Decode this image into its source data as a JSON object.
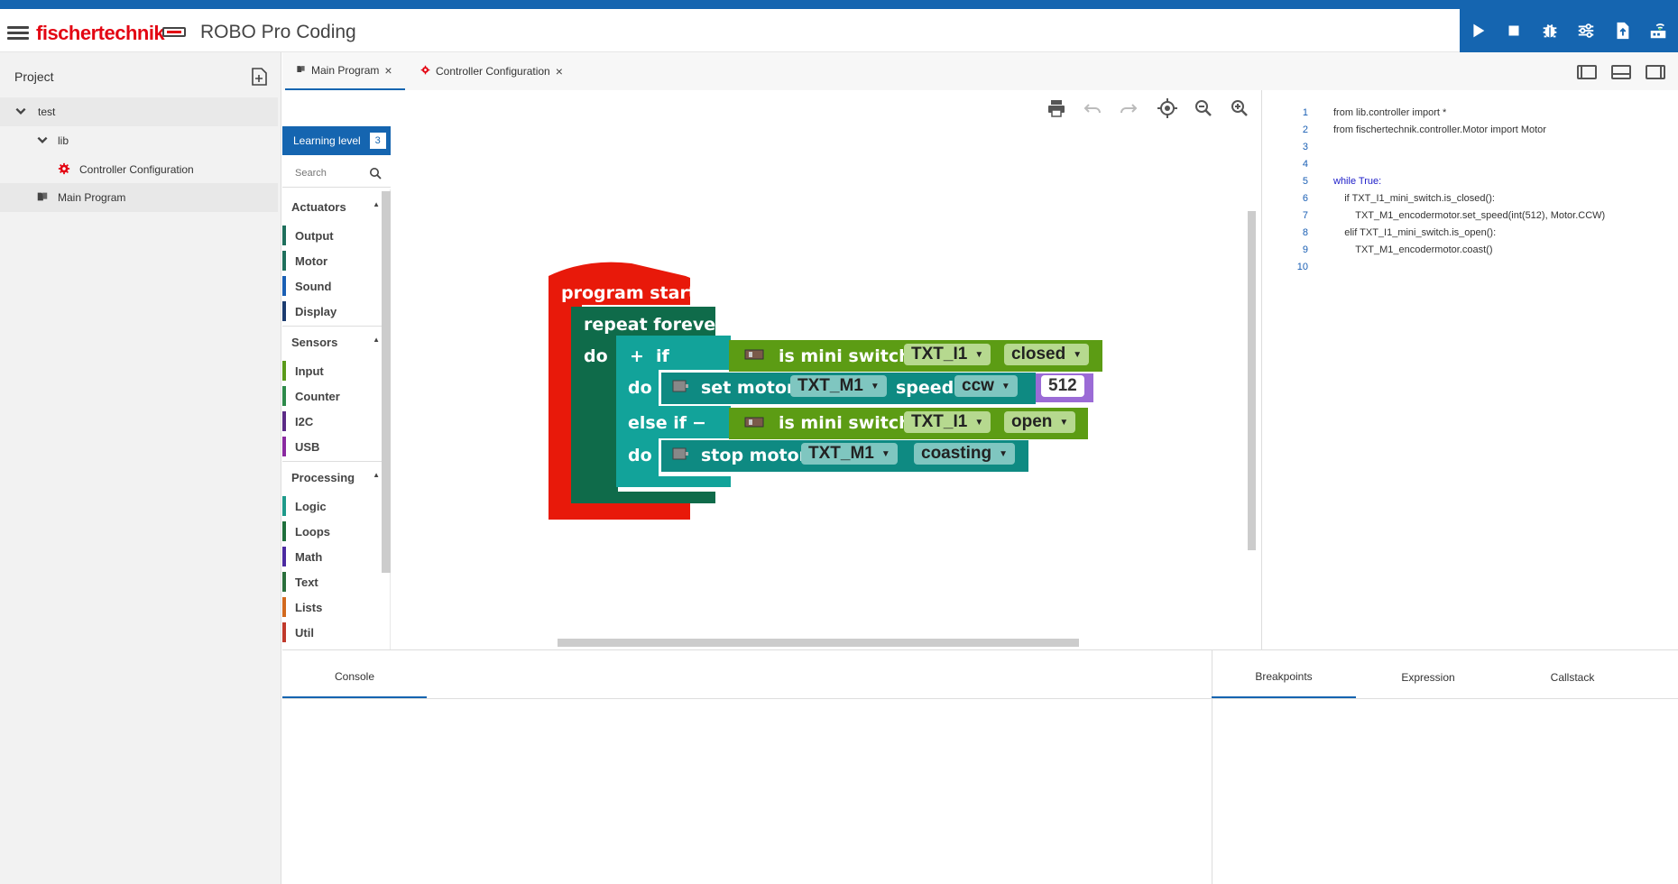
{
  "header": {
    "brand": "fischertechnik",
    "app_title": "ROBO Pro Coding",
    "colors": {
      "primary": "#1565b0",
      "brand_red": "#e30613"
    },
    "toolbar_icons": [
      "play-icon",
      "stop-icon",
      "debug-icon",
      "settings-sliders-icon",
      "upload-icon",
      "controller-connect-icon"
    ]
  },
  "sidebar": {
    "title": "Project",
    "tree": [
      {
        "label": "test",
        "icon": "chevron-down-icon"
      },
      {
        "label": "lib",
        "icon": "chevron-down-icon"
      },
      {
        "label": "Controller Configuration",
        "icon": "gear-icon"
      },
      {
        "label": "Main Program",
        "icon": "program-icon"
      }
    ]
  },
  "tabs": [
    {
      "label": "Main Program",
      "active": true
    },
    {
      "label": "Controller Configuration",
      "active": false
    }
  ],
  "toolbox": {
    "learning_label": "Learning level",
    "learning_level": "3",
    "search_placeholder": "Search",
    "categories": [
      {
        "name": "Actuators",
        "items": [
          {
            "label": "Output",
            "color": "#1e6f5c"
          },
          {
            "label": "Motor",
            "color": "#1e6f5c"
          },
          {
            "label": "Sound",
            "color": "#1a5fb4"
          },
          {
            "label": "Display",
            "color": "#1b3b6f"
          }
        ]
      },
      {
        "name": "Sensors",
        "items": [
          {
            "label": "Input",
            "color": "#5a9a1a"
          },
          {
            "label": "Counter",
            "color": "#2d8a4a"
          },
          {
            "label": "I2C",
            "color": "#5b2a86"
          },
          {
            "label": "USB",
            "color": "#8a2aa0"
          }
        ]
      },
      {
        "name": "Processing",
        "items": [
          {
            "label": "Logic",
            "color": "#1e9a8a"
          },
          {
            "label": "Loops",
            "color": "#1e6f3c"
          },
          {
            "label": "Math",
            "color": "#4b2aa0"
          },
          {
            "label": "Text",
            "color": "#2a6f3c"
          },
          {
            "label": "Lists",
            "color": "#d2691e"
          },
          {
            "label": "Util",
            "color": "#c0392b"
          }
        ]
      }
    ]
  },
  "blocks": {
    "program_start": "program start",
    "repeat_forever": "repeat forever",
    "do": "do",
    "plus": "+",
    "minus": "−",
    "if": "if",
    "else_if": "else if",
    "is_mini_switch": "is mini switch",
    "switch_1": "TXT_I1",
    "state_1": "closed",
    "set_motor": "set motor",
    "motor_1": "TXT_M1",
    "speed": "speed",
    "direction": "ccw",
    "speed_value": "512",
    "switch_2": "TXT_I1",
    "state_2": "open",
    "stop_motor": "stop motor",
    "motor_2": "TXT_M1",
    "stop_mode": "coasting",
    "colors": {
      "program": "#e8190a",
      "loop": "#0f6b4a",
      "if": "#12a39a",
      "sensor": "#5c9c14",
      "motor": "#0e8a82",
      "number": "#9b6bd6"
    }
  },
  "code": {
    "line_numbers": [
      "1",
      "2",
      "3",
      "4",
      "5",
      "6",
      "7",
      "8",
      "9",
      "10"
    ],
    "lines": [
      "from lib.controller import *",
      "from fischertechnik.controller.Motor import Motor",
      "",
      "",
      "while True:",
      "    if TXT_I1_mini_switch.is_closed():",
      "        TXT_M1_encodermotor.set_speed(int(512), Motor.CCW)",
      "    elif TXT_I1_mini_switch.is_open():",
      "        TXT_M1_encodermotor.coast()",
      ""
    ]
  },
  "bottom": {
    "console_tab": "Console",
    "debug_tabs": [
      "Breakpoints",
      "Expression",
      "Callstack"
    ]
  }
}
